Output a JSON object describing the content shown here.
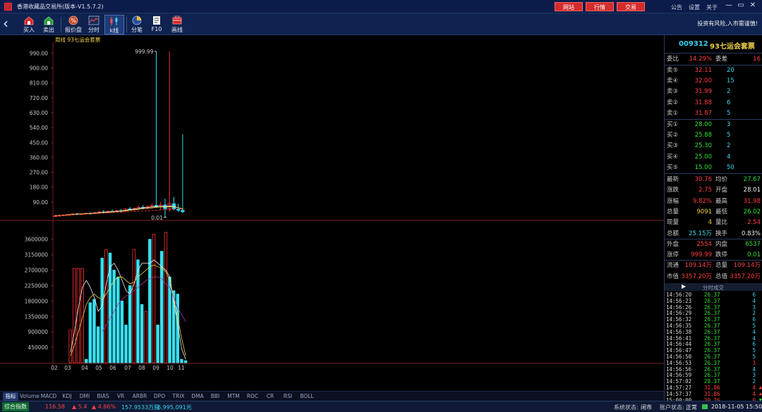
{
  "window": {
    "title": "香港收藏品交易所(版本-V1.5.7.2)",
    "top_buttons": [
      "网站",
      "行情",
      "交易"
    ],
    "links": [
      "公告",
      "设置",
      "关于"
    ],
    "controls": [
      "—",
      "▭",
      "✕"
    ]
  },
  "toolbar": {
    "back": "‹",
    "tools": [
      {
        "label": "买入",
        "icon": "buy-icon"
      },
      {
        "label": "卖出",
        "icon": "sell-icon"
      },
      {
        "label": "报价盘",
        "icon": "quote-board-icon"
      },
      {
        "label": "分时",
        "icon": "timeshare-icon"
      },
      {
        "label": "k线",
        "icon": "kline-icon",
        "active": true
      },
      {
        "label": "分笔",
        "icon": "tick-icon"
      },
      {
        "label": "F10",
        "icon": "f10-icon"
      },
      {
        "label": "画线",
        "icon": "draw-line-icon"
      }
    ],
    "risk_notice": "投资有风险,入市需谨慎!"
  },
  "chart_data": [
    {
      "type": "candlestick",
      "title": "周线 93七运会套票",
      "ylim": [
        0,
        1000
      ],
      "y_ticks": [
        "990.00",
        "900.00",
        "810.00",
        "720.00",
        "630.00",
        "540.00",
        "450.00",
        "360.00",
        "270.00",
        "180.00",
        "90.00"
      ],
      "annotations": [
        "999.99",
        "0.01"
      ],
      "bars": [
        [
          5,
          10,
          3,
          6
        ],
        [
          6,
          12,
          4,
          9
        ],
        [
          9,
          14,
          5,
          12
        ],
        [
          12,
          16,
          8,
          14
        ],
        [
          14,
          22,
          10,
          18
        ],
        [
          18,
          24,
          13,
          16
        ],
        [
          16,
          20,
          12,
          19
        ],
        [
          19,
          26,
          15,
          22
        ],
        [
          22,
          28,
          18,
          20
        ],
        [
          20,
          30,
          17,
          26
        ],
        [
          26,
          36,
          20,
          30
        ],
        [
          30,
          40,
          24,
          28
        ],
        [
          28,
          38,
          22,
          34
        ],
        [
          34,
          44,
          28,
          32
        ],
        [
          32,
          42,
          26,
          38
        ],
        [
          38,
          48,
          30,
          36
        ],
        [
          36,
          52,
          30,
          48
        ],
        [
          48,
          60,
          38,
          44
        ],
        [
          44,
          56,
          36,
          52
        ],
        [
          52,
          68,
          42,
          58
        ],
        [
          58,
          72,
          46,
          54
        ],
        [
          54,
          70,
          44,
          62
        ],
        [
          62,
          80,
          50,
          70
        ],
        [
          70,
          999.99,
          55,
          60
        ],
        [
          60,
          90,
          40,
          72
        ],
        [
          72,
          110,
          0.01,
          50
        ],
        [
          50,
          1000,
          30,
          80
        ],
        [
          80,
          120,
          40,
          48
        ],
        [
          48,
          80,
          30,
          40
        ],
        [
          40,
          500,
          25,
          30.76
        ]
      ],
      "ma": [
        {
          "color": "#f0f0f0",
          "values": [
            6,
            8,
            10,
            13,
            15,
            17,
            18,
            20,
            21,
            23,
            26,
            28,
            30,
            32,
            34,
            36,
            40,
            44,
            47,
            51,
            55,
            57,
            61,
            63,
            65,
            62,
            66,
            64,
            56,
            48
          ]
        },
        {
          "color": "#f0d24a",
          "values": [
            8,
            9,
            10,
            12,
            14,
            16,
            17,
            19,
            20,
            22,
            24,
            26,
            28,
            30,
            32,
            34,
            37,
            40,
            43,
            46,
            50,
            52,
            55,
            58,
            60,
            60,
            62,
            60,
            56,
            50
          ]
        }
      ]
    },
    {
      "type": "bar",
      "title": "",
      "ylim": [
        0,
        3800000
      ],
      "y_ticks": [
        "3600000",
        "3150000",
        "2700000",
        "2250000",
        "1800000",
        "1350000",
        "900000",
        "450000"
      ],
      "x_ticks": [
        "02",
        "03",
        "04",
        "05",
        "06",
        "07",
        "08",
        "09",
        "10",
        "11"
      ],
      "bars": [
        {
          "v": 950000,
          "c": "r"
        },
        {
          "v": 2750000,
          "c": "r"
        },
        {
          "v": 2750000,
          "c": "r"
        },
        {
          "v": 2750000,
          "c": "r"
        },
        {
          "v": 100000,
          "c": "c"
        },
        {
          "v": 1750000,
          "c": "c"
        },
        {
          "v": 1850000,
          "c": "c"
        },
        {
          "v": 1050000,
          "c": "c"
        },
        {
          "v": 3050000,
          "c": "c"
        },
        {
          "v": 3300000,
          "c": "r"
        },
        {
          "v": 3200000,
          "c": "c"
        },
        {
          "v": 2700000,
          "c": "c"
        },
        {
          "v": 2500000,
          "c": "c"
        },
        {
          "v": 1800000,
          "c": "c"
        },
        {
          "v": 1100000,
          "c": "c"
        },
        {
          "v": 2250000,
          "c": "c"
        },
        {
          "v": 3300000,
          "c": "r"
        },
        {
          "v": 3000000,
          "c": "c"
        },
        {
          "v": 1700000,
          "c": "c"
        },
        {
          "v": 1500000,
          "c": "r"
        },
        {
          "v": 3600000,
          "c": "c"
        },
        {
          "v": 3750000,
          "c": "r"
        },
        {
          "v": 1100000,
          "c": "c"
        },
        {
          "v": 3250000,
          "c": "c"
        },
        {
          "v": 3800000,
          "c": "r"
        },
        {
          "v": 2500000,
          "c": "c"
        },
        {
          "v": 2100000,
          "c": "c"
        },
        {
          "v": 2000000,
          "c": "c"
        },
        {
          "v": 100000,
          "c": "c"
        },
        {
          "v": 60000,
          "c": "c"
        }
      ],
      "ma": [
        {
          "color": "#f0f0f0",
          "values": [
            300000,
            900000,
            1600000,
            2200000,
            2400000,
            2200000,
            1900000,
            1500000,
            1650000,
            2300000,
            2800000,
            2900000,
            2700000,
            2400000,
            2100000,
            2000000,
            2300000,
            2700000,
            2900000,
            2900000,
            2900000,
            3000000,
            2900000,
            2800000,
            2700000,
            2500000,
            1800000,
            1100000,
            400000,
            100000
          ]
        },
        {
          "color": "#f0d24a",
          "values": [
            200000,
            500000,
            900000,
            1300000,
            1700000,
            1900000,
            2000000,
            1900000,
            1850000,
            2000000,
            2200000,
            2400000,
            2500000,
            2500000,
            2400000,
            2300000,
            2350000,
            2500000,
            2600000,
            2700000,
            2800000,
            2850000,
            2800000,
            2750000,
            2650000,
            2400000,
            1900000,
            1300000,
            700000,
            200000
          ]
        },
        {
          "color": "#b0309c",
          "values": [
            null,
            null,
            null,
            null,
            null,
            null,
            null,
            null,
            900000,
            1100000,
            1300000,
            1500000,
            1700000,
            1850000,
            1950000,
            2000000,
            2100000,
            2200000,
            2300000,
            2400000,
            2450000,
            2500000,
            2500000,
            2450000,
            2300000,
            2200000,
            1900000,
            1600000,
            1400000,
            1200000
          ]
        }
      ]
    }
  ],
  "indicator_tabs": [
    "指标",
    "Volume",
    "MACD",
    "KDJ",
    "DMI",
    "BIAS",
    "VR",
    "ARBR",
    "DPO",
    "TRIX",
    "DMA",
    "BBI",
    "MTM",
    "ROC",
    "CR",
    "RSI",
    "BOLL"
  ],
  "status": {
    "index_label": "综合指数",
    "index_value": "116.58",
    "change": "▲ 5.4",
    "change_pct": "▲ 4.86%",
    "volume": "157.9533万股",
    "amount": "6,995,091元",
    "system_label": "系统状态:",
    "system_value": "闭市",
    "account_label": "账户状态:",
    "account_value": "正常",
    "datetime": "2018-11-05 15:50:41"
  },
  "quote": {
    "code": "009312",
    "name": "93七运会套票",
    "weibi_label": "委比",
    "weibi": "14.29%",
    "weicha_label": "委差",
    "weicha": "16",
    "asks": [
      {
        "label": "卖⑤",
        "price": "32.11",
        "vol": "20"
      },
      {
        "label": "卖④",
        "price": "32.00",
        "vol": "15"
      },
      {
        "label": "卖③",
        "price": "31.99",
        "vol": "2"
      },
      {
        "label": "卖②",
        "price": "31.88",
        "vol": "6"
      },
      {
        "label": "卖①",
        "price": "31.87",
        "vol": "5"
      }
    ],
    "bids": [
      {
        "label": "买①",
        "price": "28.00",
        "vol": "3"
      },
      {
        "label": "买②",
        "price": "25.88",
        "vol": "5"
      },
      {
        "label": "买③",
        "price": "25.30",
        "vol": "2"
      },
      {
        "label": "买④",
        "price": "25.00",
        "vol": "4"
      },
      {
        "label": "买⑤",
        "price": "15.00",
        "vol": "50"
      }
    ],
    "stats": [
      {
        "l1": "最新",
        "v1": "30.76",
        "c1": "red",
        "l2": "均价",
        "v2": "27.67",
        "c2": "green"
      },
      {
        "l1": "涨跌",
        "v1": "2.75",
        "c1": "red",
        "l2": "开盘",
        "v2": "28.01",
        "c2": "white"
      },
      {
        "l1": "涨幅",
        "v1": "9.82%",
        "c1": "red",
        "l2": "最高",
        "v2": "31.98",
        "c2": "red"
      },
      {
        "l1": "总量",
        "v1": "9091",
        "c1": "yellow",
        "l2": "最低",
        "v2": "26.02",
        "c2": "green"
      },
      {
        "l1": "现量",
        "v1": "4",
        "c1": "yellow",
        "l2": "量比",
        "v2": "2.54",
        "c2": "red"
      },
      {
        "l1": "总额",
        "v1": "25.15万",
        "c1": "cyan",
        "l2": "换手",
        "v2": "0.83%",
        "c2": "white"
      },
      {
        "l1": "外盘",
        "v1": "2554",
        "c1": "red",
        "l2": "内盘",
        "v2": "6537",
        "c2": "green"
      },
      {
        "l1": "涨停",
        "v1": "999.99",
        "c1": "red",
        "l2": "跌停",
        "v2": "0.01",
        "c2": "green"
      },
      {
        "l1": "流通",
        "v1": "109.14万",
        "c1": "red",
        "l2": "总量",
        "v2": "109.14万",
        "c2": "red"
      },
      {
        "l1": "市值",
        "v1": "3357.20万",
        "c1": "red",
        "l2": "总值",
        "v2": "3357.20万",
        "c2": "red"
      }
    ],
    "tick_arrow": "▶",
    "tick_title": "分时成交",
    "ticks": [
      {
        "t": "14:56:20",
        "p": "26.37",
        "pc": "green",
        "v": "6",
        "vc": "cyan",
        "a": ""
      },
      {
        "t": "14:56:23",
        "p": "26.37",
        "pc": "green",
        "v": "4",
        "vc": "cyan",
        "a": ""
      },
      {
        "t": "14:56:26",
        "p": "26.37",
        "pc": "green",
        "v": "3",
        "vc": "cyan",
        "a": ""
      },
      {
        "t": "14:56:29",
        "p": "26.37",
        "pc": "green",
        "v": "2",
        "vc": "cyan",
        "a": ""
      },
      {
        "t": "14:56:32",
        "p": "26.37",
        "pc": "green",
        "v": "6",
        "vc": "cyan",
        "a": ""
      },
      {
        "t": "14:56:35",
        "p": "26.37",
        "pc": "green",
        "v": "5",
        "vc": "cyan",
        "a": ""
      },
      {
        "t": "14:56:38",
        "p": "26.37",
        "pc": "green",
        "v": "4",
        "vc": "cyan",
        "a": ""
      },
      {
        "t": "14:56:41",
        "p": "26.37",
        "pc": "green",
        "v": "4",
        "vc": "cyan",
        "a": ""
      },
      {
        "t": "14:56:44",
        "p": "26.37",
        "pc": "green",
        "v": "6",
        "vc": "cyan",
        "a": ""
      },
      {
        "t": "14:56:47",
        "p": "26.37",
        "pc": "green",
        "v": "5",
        "vc": "cyan",
        "a": ""
      },
      {
        "t": "14:56:50",
        "p": "26.37",
        "pc": "green",
        "v": "5",
        "vc": "cyan",
        "a": ""
      },
      {
        "t": "14:56:53",
        "p": "26.37",
        "pc": "green",
        "v": "3",
        "vc": "red",
        "a": ""
      },
      {
        "t": "14:56:56",
        "p": "26.37",
        "pc": "green",
        "v": "4",
        "vc": "cyan",
        "a": ""
      },
      {
        "t": "14:56:59",
        "p": "26.37",
        "pc": "green",
        "v": "3",
        "vc": "cyan",
        "a": ""
      },
      {
        "t": "14:57:02",
        "p": "28.37",
        "pc": "green",
        "v": "2",
        "vc": "cyan",
        "a": ""
      },
      {
        "t": "14:57:27",
        "p": "31.86",
        "pc": "red",
        "v": "4",
        "vc": "red",
        "a": "▲",
        "ac": "red"
      },
      {
        "t": "14:57:37",
        "p": "31.86",
        "pc": "red",
        "v": "4",
        "vc": "red",
        "a": "▲",
        "ac": "red"
      },
      {
        "t": "15:00:00",
        "p": "30.76",
        "pc": "red",
        "v": "0",
        "vc": "red",
        "a": "▼",
        "ac": "green"
      }
    ]
  }
}
